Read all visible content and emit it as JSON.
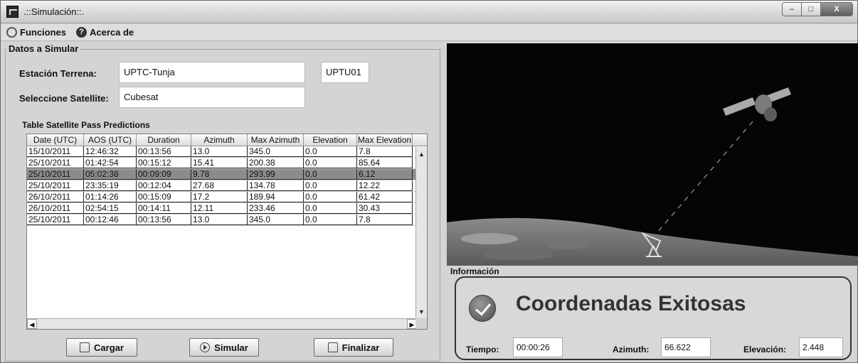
{
  "window": {
    "title": ".::Simulación::."
  },
  "menu": {
    "items": [
      "Funciones",
      "Acerca de"
    ]
  },
  "form": {
    "legend": "Datos a Simular",
    "station_label": "Estación Terrena:",
    "station_value": "UPTC-Tunja",
    "station_code": "UPTU01",
    "satellite_label": "Seleccione Satellite:",
    "satellite_value": "Cubesat"
  },
  "table": {
    "title": "Table Satellite Pass Predictions",
    "columns": [
      "Date (UTC)",
      "AOS (UTC)",
      "Duration",
      "Azimuth",
      "Max Azimuth",
      "Elevation",
      "Max Elevation"
    ],
    "rows": [
      [
        "15/10/2011",
        "12:46:32",
        "00:13:56",
        "13.0",
        "345.0",
        "0.0",
        "7.8"
      ],
      [
        "25/10/2011",
        "01:42:54",
        "00:15:12",
        "15.41",
        "200.38",
        "0.0",
        "85.64"
      ],
      [
        "25/10/2011",
        "05:02:38",
        "00:09:09",
        "9.78",
        "293.99",
        "0.0",
        "6.12"
      ],
      [
        "25/10/2011",
        "23:35:19",
        "00:12:04",
        "27.68",
        "134.78",
        "0.0",
        "12.22"
      ],
      [
        "26/10/2011",
        "01:14:26",
        "00:15:09",
        "17.2",
        "189.94",
        "0.0",
        "61.42"
      ],
      [
        "26/10/2011",
        "02:54:15",
        "00:14:11",
        "12.11",
        "233.46",
        "0.0",
        "30.43"
      ],
      [
        "25/10/2011",
        "00:12:46",
        "00:13:56",
        "13.0",
        "345.0",
        "0.0",
        "7.8"
      ]
    ],
    "selected_row": 2
  },
  "buttons": {
    "load": "Cargar",
    "simulate": "Simular",
    "finish": "Finalizar"
  },
  "info": {
    "legend": "Información",
    "status": "Coordenadas Exitosas",
    "time_label": "Tiempo:",
    "time_value": "00:00:26",
    "azimuth_label": "Azimuth:",
    "azimuth_value": "66.622",
    "elevation_label": "Elevación:",
    "elevation_value": "2.448"
  }
}
